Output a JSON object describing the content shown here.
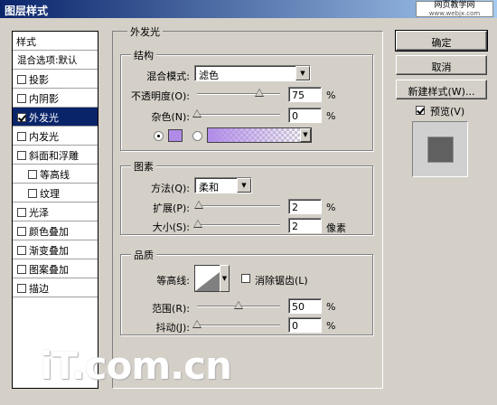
{
  "window": {
    "title": "图层样式",
    "watermark_line1": "网页教学网",
    "watermark_line2": "www.webjx.com"
  },
  "style_list": {
    "header": "样式",
    "blend_options": "混合选项:默认",
    "items": [
      {
        "label": "投影",
        "checked": false,
        "selected": false,
        "indent": false
      },
      {
        "label": "内阴影",
        "checked": false,
        "selected": false,
        "indent": false
      },
      {
        "label": "外发光",
        "checked": true,
        "selected": true,
        "indent": false
      },
      {
        "label": "内发光",
        "checked": false,
        "selected": false,
        "indent": false
      },
      {
        "label": "斜面和浮雕",
        "checked": false,
        "selected": false,
        "indent": false
      },
      {
        "label": "等高线",
        "checked": false,
        "selected": false,
        "indent": true
      },
      {
        "label": "纹理",
        "checked": false,
        "selected": false,
        "indent": true
      },
      {
        "label": "光泽",
        "checked": false,
        "selected": false,
        "indent": false
      },
      {
        "label": "颜色叠加",
        "checked": false,
        "selected": false,
        "indent": false
      },
      {
        "label": "渐变叠加",
        "checked": false,
        "selected": false,
        "indent": false
      },
      {
        "label": "图案叠加",
        "checked": false,
        "selected": false,
        "indent": false
      },
      {
        "label": "描边",
        "checked": false,
        "selected": false,
        "indent": false
      }
    ]
  },
  "outer_glow": {
    "title": "外发光",
    "structure": {
      "title": "结构",
      "blend_mode_label": "混合模式:",
      "blend_mode_value": "滤色",
      "opacity_label": "不透明度(O):",
      "opacity_value": "75",
      "opacity_unit": "%",
      "opacity_fraction": 0.75,
      "noise_label": "杂色(N):",
      "noise_value": "0",
      "noise_unit": "%",
      "noise_fraction": 0.0,
      "swatch_color": "#b08be8",
      "color_mode": "solid"
    },
    "elements": {
      "title": "图素",
      "method_label": "方法(Q):",
      "method_value": "柔和",
      "spread_label": "扩展(P):",
      "spread_value": "2",
      "spread_unit": "%",
      "spread_fraction": 0.02,
      "size_label": "大小(S):",
      "size_value": "2",
      "size_unit": "像素",
      "size_fraction": 0.008
    },
    "quality": {
      "title": "品质",
      "contour_label": "等高线:",
      "antialias_label": "消除锯齿(L)",
      "antialias_checked": false,
      "range_label": "范围(R):",
      "range_value": "50",
      "range_unit": "%",
      "range_fraction": 0.5,
      "jitter_label": "抖动(J):",
      "jitter_value": "0",
      "jitter_unit": "%",
      "jitter_fraction": 0.0
    }
  },
  "buttons": {
    "ok": "确定",
    "cancel": "取消",
    "new_style": "新建样式(W)...",
    "preview_label": "预览(V)",
    "preview_checked": true
  },
  "logo_text": "iT.com.cn"
}
